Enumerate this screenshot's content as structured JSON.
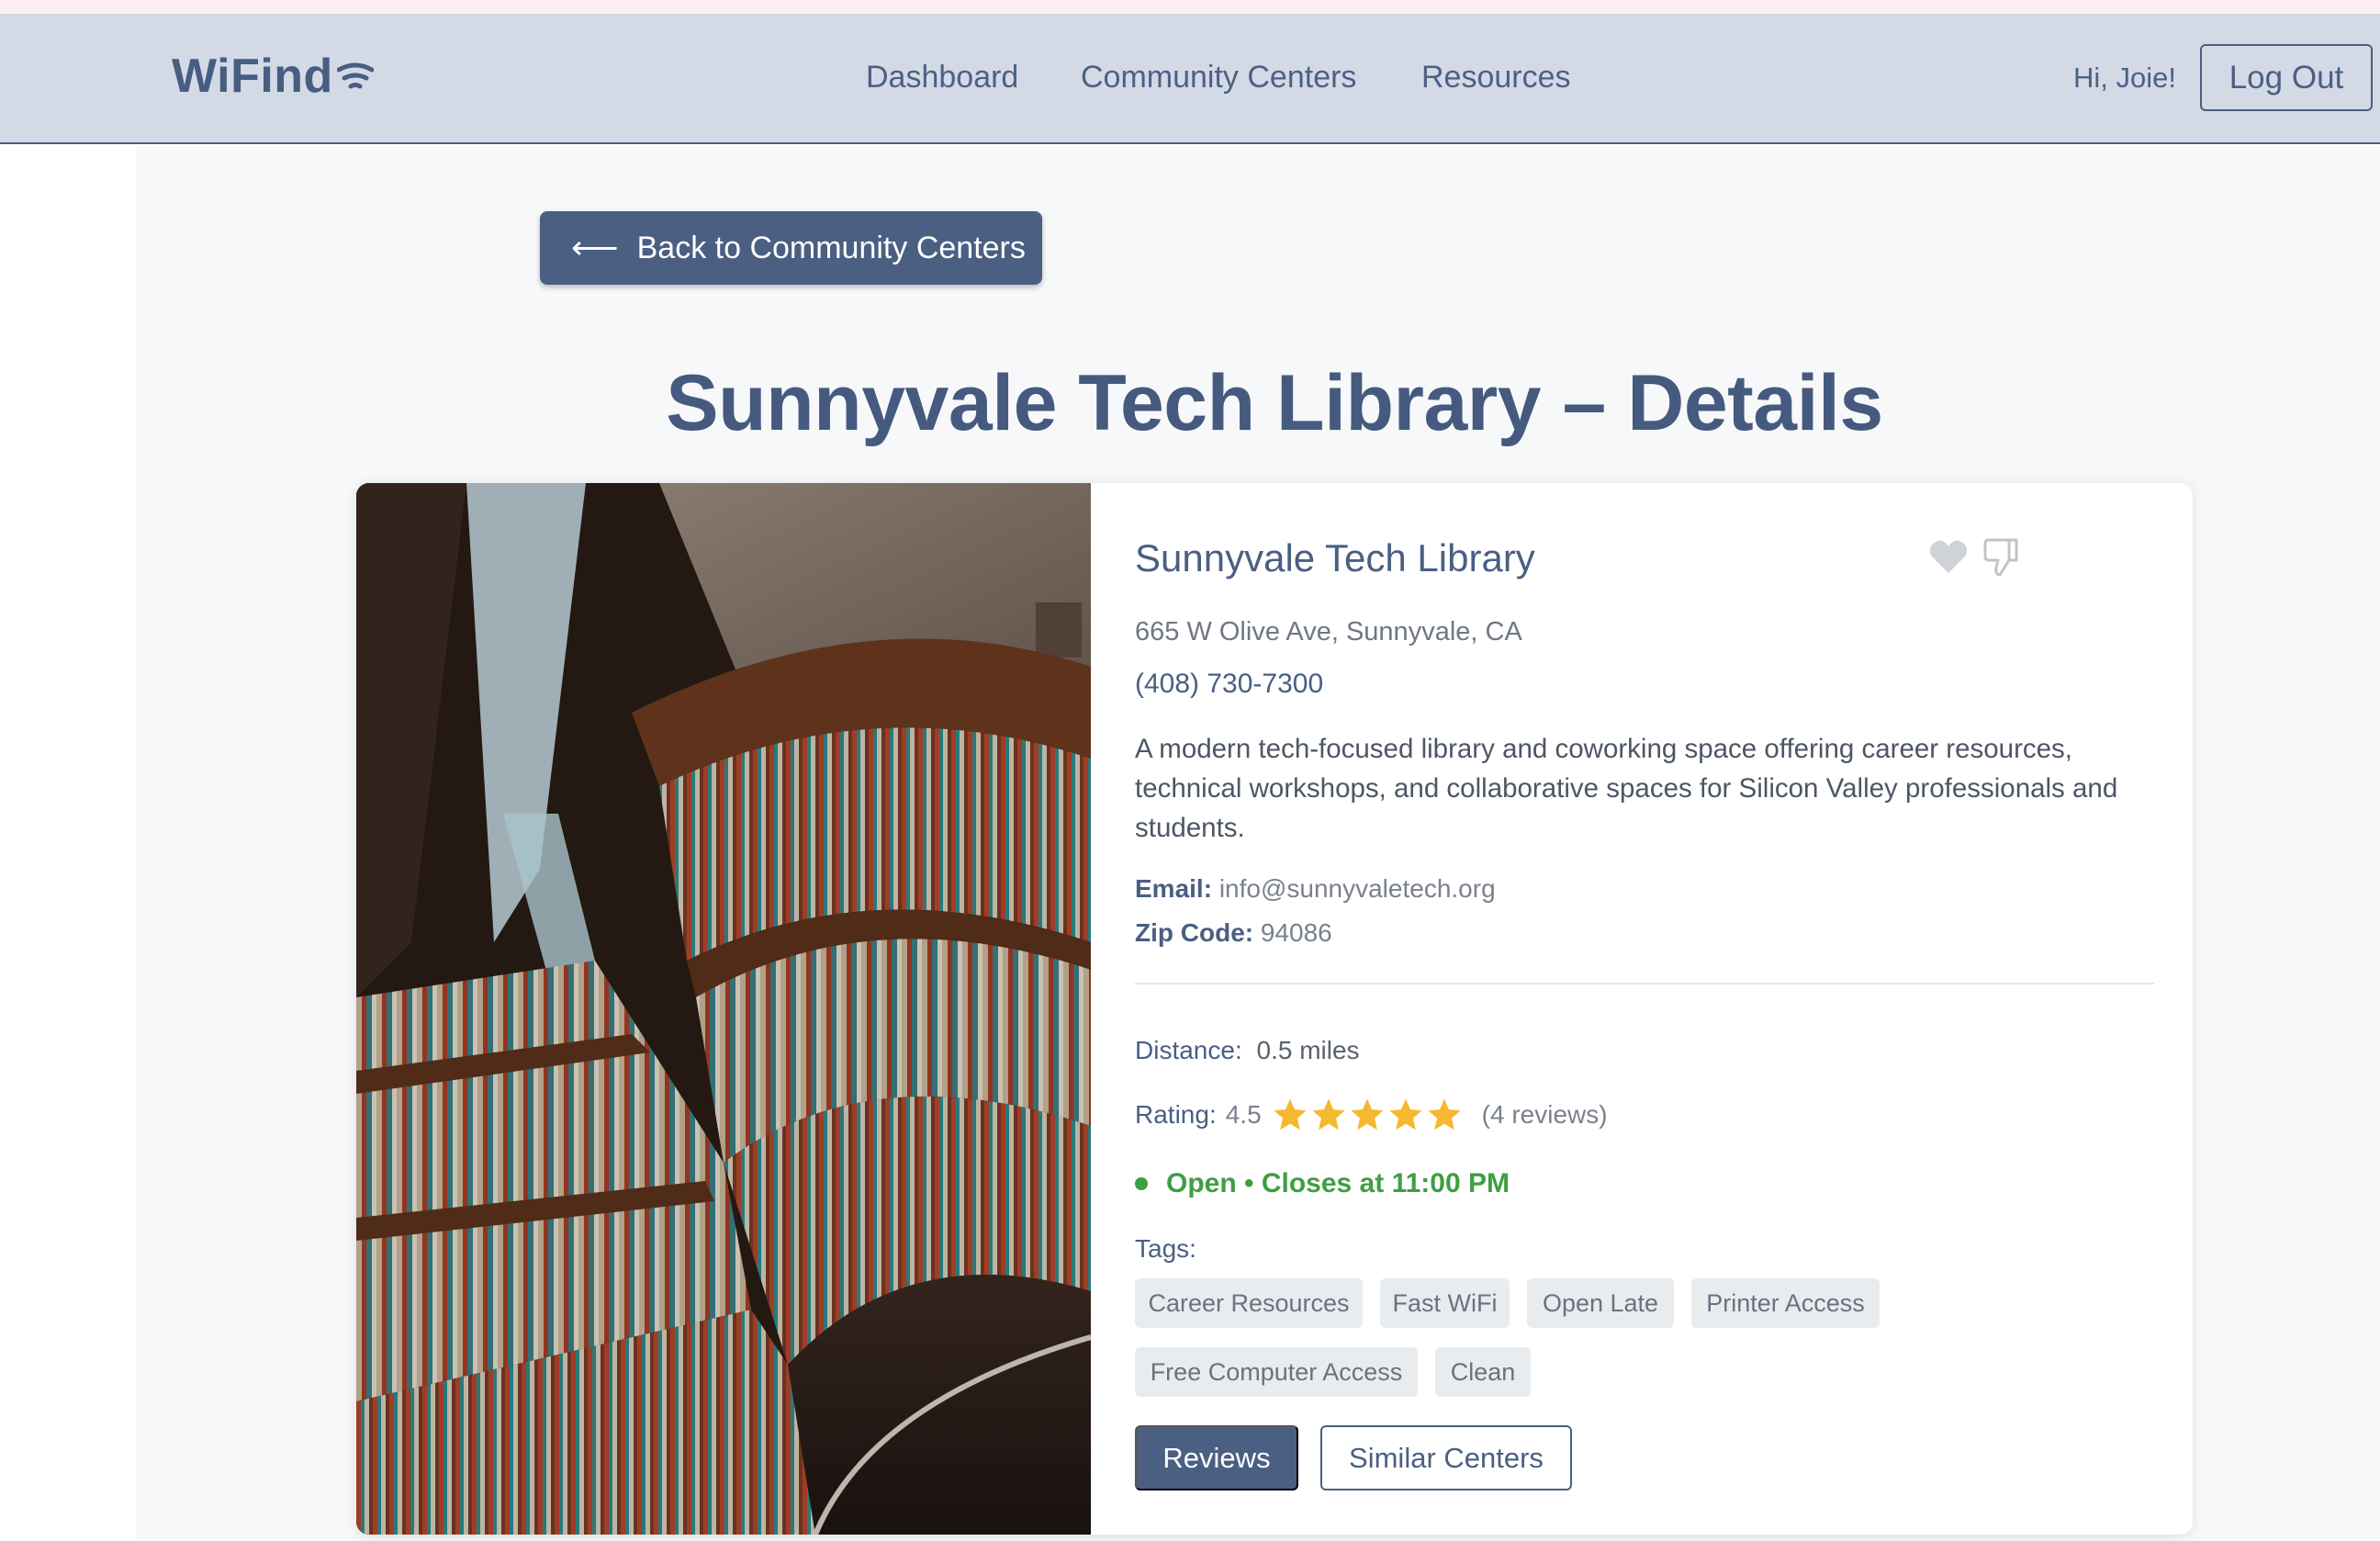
{
  "nav": {
    "logo": "WiFind",
    "links": [
      "Dashboard",
      "Community Centers",
      "Resources"
    ],
    "greeting": "Hi, Joie!",
    "logout_label": "Log Out"
  },
  "back_button_label": "Back to Community Centers",
  "page_title": "Sunnyvale Tech Library – Details",
  "center": {
    "name": "Sunnyvale Tech Library",
    "address": "665 W Olive Ave, Sunnyvale, CA",
    "phone": "(408) 730-7300",
    "description": "A modern tech-focused library and coworking space offering career resources, technical workshops, and collaborative spaces for Silicon Valley professionals and students.",
    "email_label": "Email:",
    "email": "info@sunnyvaletech.org",
    "zip_label": "Zip Code:",
    "zip": "94086",
    "distance_label": "Distance:",
    "distance": "0.5 miles",
    "rating_label": "Rating:",
    "rating": "4.5",
    "stars": 5,
    "reviews_count": "(4 reviews)",
    "status": "Open • Closes at 11:00 PM",
    "tags_label": "Tags:",
    "tags": [
      "Career Resources",
      "Fast WiFi",
      "Open Late",
      "Printer Access",
      "Free Computer Access",
      "Clean"
    ],
    "favorite_icon": "heart-icon",
    "dislike_icon": "thumbs-down-icon"
  },
  "actions": {
    "reviews_label": "Reviews",
    "similar_label": "Similar Centers"
  },
  "colors": {
    "navbar_bg": "#d3dae6",
    "primary": "#4a5f82",
    "open_status": "#3f9e44",
    "star": "#f5b82e",
    "tag_bg": "#e9ecef"
  }
}
